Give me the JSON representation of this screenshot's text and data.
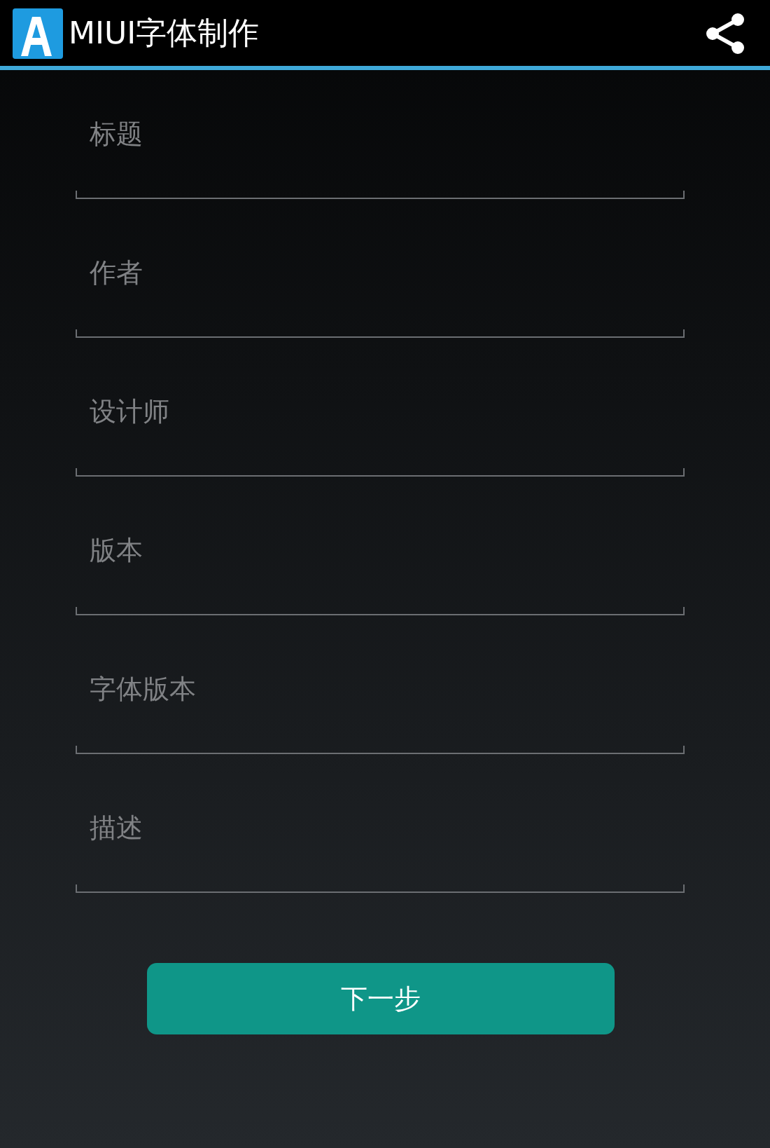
{
  "action_bar": {
    "title": "MIUI字体制作"
  },
  "fields": [
    {
      "placeholder": "标题"
    },
    {
      "placeholder": "作者"
    },
    {
      "placeholder": "设计师"
    },
    {
      "placeholder": "版本"
    },
    {
      "placeholder": "字体版本"
    },
    {
      "placeholder": "描述"
    }
  ],
  "next_button": "下一步"
}
